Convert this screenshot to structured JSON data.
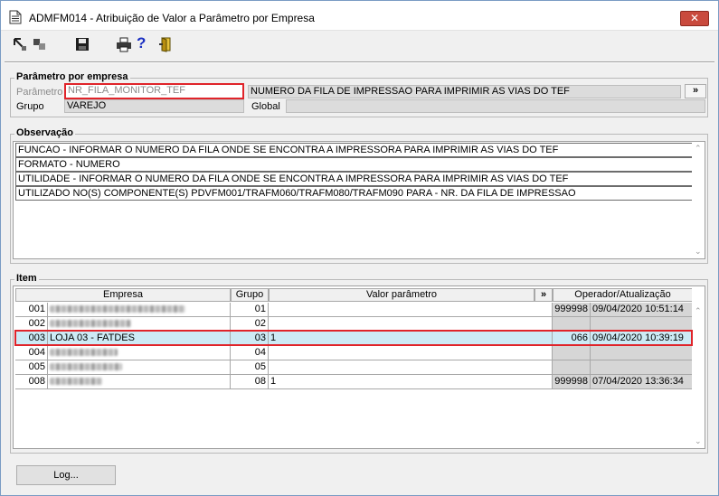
{
  "window": {
    "title": "ADMFM014 - Atribuição de Valor a Parâmetro por Empresa",
    "close_glyph": "✕"
  },
  "toolbar": {
    "icons": [
      "import-icon",
      "export-icon",
      "save-icon",
      "print-icon",
      "help-icon",
      "exit-door-icon"
    ],
    "help_glyph": "?"
  },
  "parametro_empresa": {
    "legend": "Parâmetro por empresa",
    "parametro_label": "Parâmetro",
    "parametro_value": "NR_FILA_MONITOR_TEF",
    "parametro_desc": "NUMERO DA FILA DE IMPRESSAO PARA IMPRIMIR AS VIAS DO TEF",
    "expand_label": "»",
    "grupo_label": "Grupo",
    "grupo_value": "VAREJO",
    "global_label": "Global",
    "global_value": ""
  },
  "observacao": {
    "legend": "Observação",
    "lines": [
      "FUNCAO - INFORMAR O NUMERO DA FILA ONDE SE ENCONTRA A IMPRESSORA PARA IMPRIMIR AS VIAS DO TEF",
      "FORMATO - NUMERO",
      "UTILIDADE - INFORMAR O NUMERO DA FILA ONDE SE ENCONTRA A IMPRESSORA PARA IMPRIMIR AS VIAS DO TEF",
      "UTILIZADO NO(S) COMPONENTE(S) PDVFM001/TRAFM060/TRAFM080/TRAFM090  PARA  - NR. DA FILA DE IMPRESSAO"
    ]
  },
  "item": {
    "legend": "Item",
    "headers": {
      "empresa": "Empresa",
      "grupo": "Grupo",
      "valor": "Valor parâmetro",
      "expand": "»",
      "operador": "Operador/Atualização"
    },
    "rows": [
      {
        "code": "001",
        "empresa": "",
        "grupo": "01",
        "valor": "",
        "operador": "999998",
        "data": "09/04/2020 10:51:14",
        "selected": false
      },
      {
        "code": "002",
        "empresa": "",
        "grupo": "02",
        "valor": "",
        "operador": "",
        "data": "",
        "selected": false
      },
      {
        "code": "003",
        "empresa": "LOJA 03 - FATDES",
        "grupo": "03",
        "valor": "1",
        "operador": "066",
        "data": "09/04/2020 10:39:19",
        "selected": true
      },
      {
        "code": "004",
        "empresa": "",
        "grupo": "04",
        "valor": "",
        "operador": "",
        "data": "",
        "selected": false
      },
      {
        "code": "005",
        "empresa": "",
        "grupo": "05",
        "valor": "",
        "operador": "",
        "data": "",
        "selected": false
      },
      {
        "code": "008",
        "empresa": "",
        "grupo": "08",
        "valor": "1",
        "operador": "999998",
        "data": "07/04/2020 13:36:34",
        "selected": false
      }
    ]
  },
  "log_button": "Log...",
  "scroll": {
    "up": "⌃",
    "down": "⌄"
  }
}
